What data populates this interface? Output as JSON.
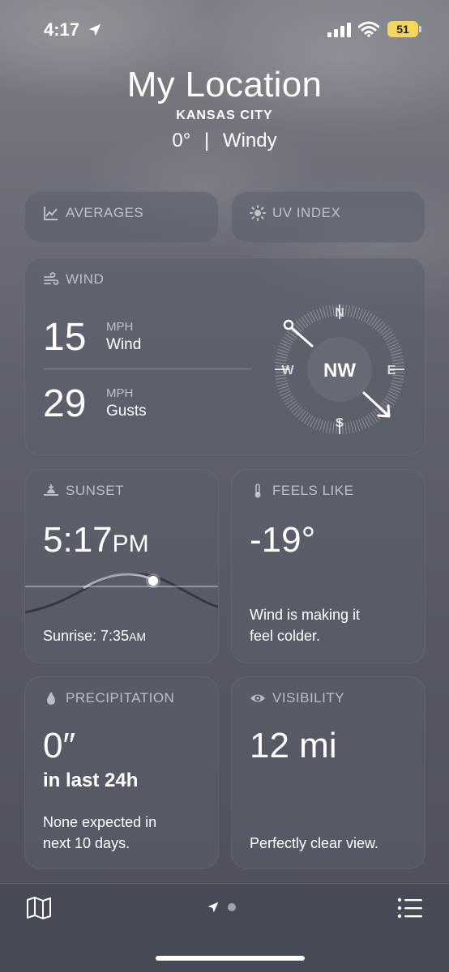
{
  "status_bar": {
    "time": "4:17",
    "battery": "51"
  },
  "header": {
    "title": "My Location",
    "city": "KANSAS CITY",
    "temp": "0°",
    "separator": "|",
    "condition": "Windy"
  },
  "averages": {
    "label": "AVERAGES"
  },
  "uv_index": {
    "label": "UV INDEX"
  },
  "wind": {
    "label": "WIND",
    "speed": "15",
    "speed_unit": "MPH",
    "speed_label": "Wind",
    "gusts": "29",
    "gusts_unit": "MPH",
    "gusts_label": "Gusts",
    "direction": "NW",
    "compass": {
      "n": "N",
      "e": "E",
      "s": "S",
      "w": "W"
    }
  },
  "sunset": {
    "label": "SUNSET",
    "time": "5:17",
    "ampm": "PM",
    "sunrise_prefix": "Sunrise: ",
    "sunrise_time": "7:35",
    "sunrise_ampm": "AM"
  },
  "feels_like": {
    "label": "FEELS LIKE",
    "value": "-19°",
    "note_line1": "Wind is making it",
    "note_line2": "feel colder."
  },
  "precipitation": {
    "label": "PRECIPITATION",
    "value": "0″",
    "period": "in last 24h",
    "note_line1": "None expected in",
    "note_line2": "next 10 days."
  },
  "visibility": {
    "label": "VISIBILITY",
    "value": "12 mi",
    "note": "Perfectly clear view."
  },
  "icons": {
    "map": "map-icon",
    "location": "location-arrow-icon",
    "list": "list-icon"
  }
}
